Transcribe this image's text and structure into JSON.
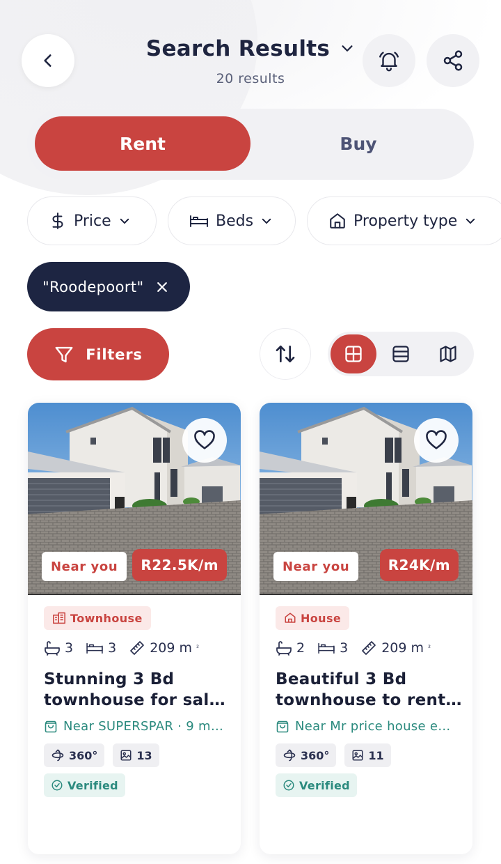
{
  "header": {
    "title": "Search Results",
    "results_count": "20 results"
  },
  "segment": {
    "rent_label": "Rent",
    "buy_label": "Buy",
    "selected": "Rent"
  },
  "filter_chips": {
    "price": "Price",
    "beds": "Beds",
    "property_type": "Property type"
  },
  "location_chip": {
    "label": "\"Roodepoort\""
  },
  "toolbar": {
    "filters_label": "Filters",
    "view_selected": "grid"
  },
  "listings": [
    {
      "near_label": "Near you",
      "price": "R22.5K/m",
      "type": "Townhouse",
      "bathrooms": "3",
      "bedrooms": "3",
      "size": "209 m",
      "size_unit": "²",
      "title": "Stunning 3 Bd townhouse for sal…",
      "nearby": "Near SUPERSPAR · 9 m…",
      "tour": "360°",
      "photos": "13",
      "verified": "Verified"
    },
    {
      "near_label": "Near you",
      "price": "R24K/m",
      "type": "House",
      "bathrooms": "2",
      "bedrooms": "3",
      "size": "209 m",
      "size_unit": "²",
      "title": "Beautiful 3 Bd townhouse to rent…",
      "nearby": "Near Mr price house e…",
      "tour": "360°",
      "photos": "11",
      "verified": "Verified"
    }
  ],
  "colors": {
    "accent": "#c94440",
    "navy": "#1d2542",
    "teal": "#2b8a7e",
    "muted_bg": "#f1f1f4"
  }
}
